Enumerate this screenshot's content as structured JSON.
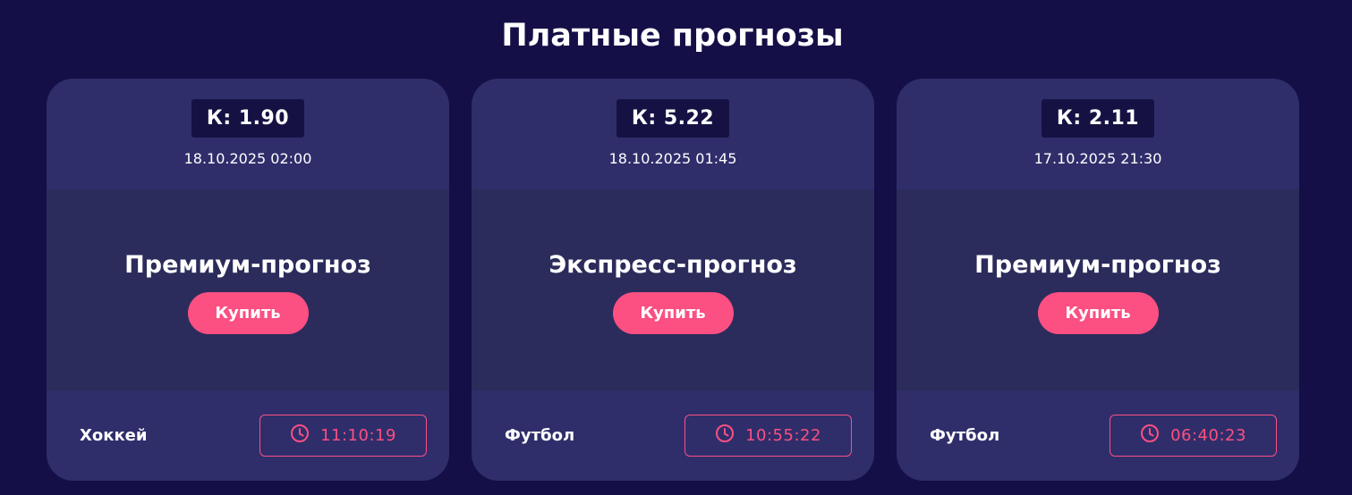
{
  "page": {
    "title": "Платные прогнозы",
    "background": "#140f46",
    "accent": "#fc4f82"
  },
  "cards": [
    {
      "coefficient": "К: 1.90",
      "date": "18.10.2025 02:00",
      "forecast_type": "Премиум-прогноз",
      "buy_label": "Купить",
      "sport": "Хоккей",
      "timer": "11:10:19",
      "timer_icon": "clock-icon"
    },
    {
      "coefficient": "К: 5.22",
      "date": "18.10.2025 01:45",
      "forecast_type": "Экспресс-прогноз",
      "buy_label": "Купить",
      "sport": "Футбол",
      "timer": "10:55:22",
      "timer_icon": "clock-icon"
    },
    {
      "coefficient": "К: 2.11",
      "date": "17.10.2025 21:30",
      "forecast_type": "Премиум-прогноз",
      "buy_label": "Купить",
      "sport": "Футбол",
      "timer": "06:40:23",
      "timer_icon": "clock-icon"
    }
  ]
}
